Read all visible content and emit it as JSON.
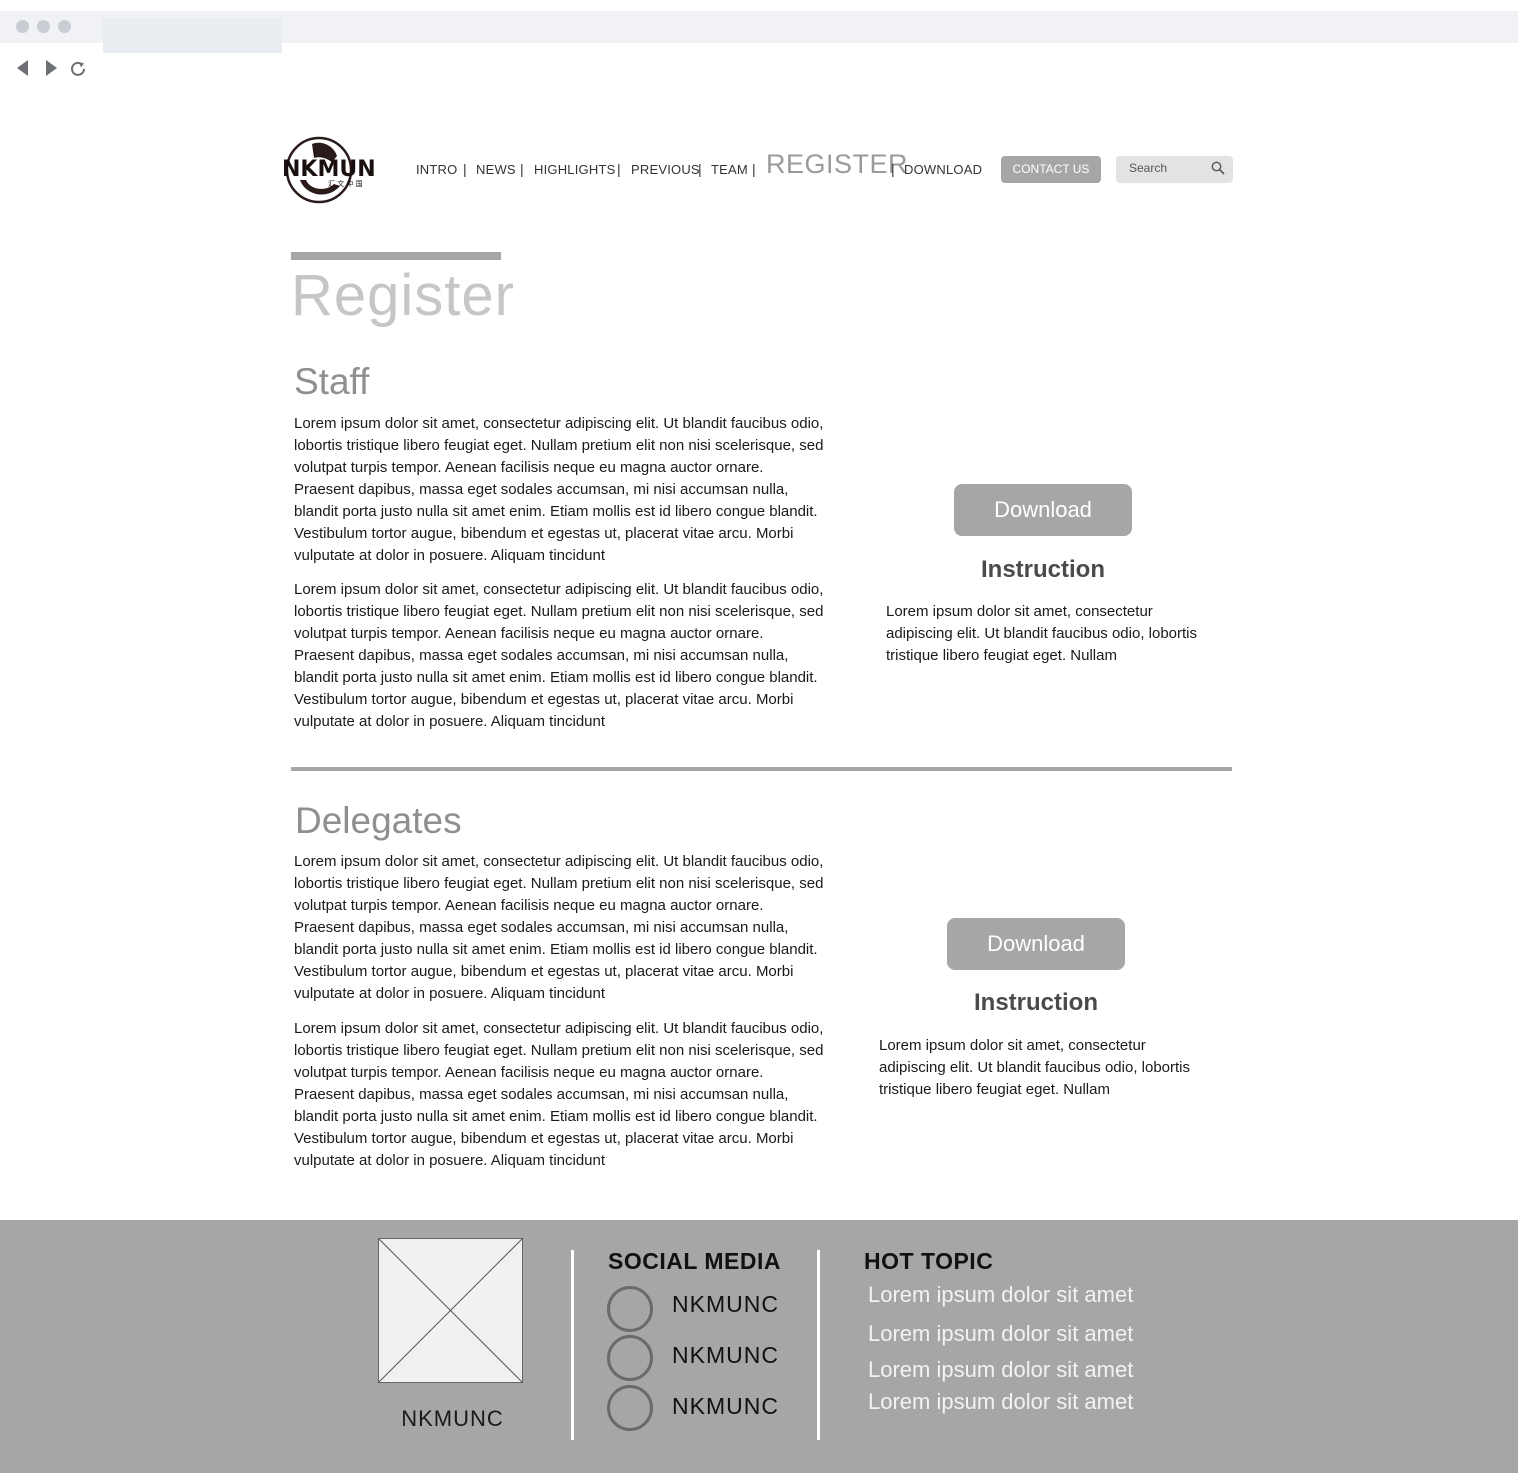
{
  "nav": {
    "items": [
      "INTRO",
      "NEWS",
      "HIGHLIGHTS",
      "PREVIOUS",
      "TEAM"
    ],
    "separator": "|",
    "register": "REGISTER",
    "download": "DOWNLOAD",
    "contact": "CONTACT US",
    "search_placeholder": "Search"
  },
  "logo": {
    "text": "NKMUN",
    "sub": "汇 文 中 国"
  },
  "page": {
    "title": "Register"
  },
  "sections": [
    {
      "title": "Staff",
      "paragraphs": [
        "Lorem ipsum dolor sit amet, consectetur adipiscing elit. Ut blandit faucibus odio, lobortis tristique libero feugiat eget. Nullam pretium elit non nisi scelerisque, sed volutpat turpis tempor. Aenean facilisis neque eu magna auctor ornare. Praesent dapibus, massa eget sodales accumsan, mi nisi accumsan nulla, blandit porta justo nulla sit amet enim. Etiam mollis est id libero congue blandit. Vestibulum tortor augue, bibendum et egestas ut, placerat vitae arcu. Morbi vulputate at dolor in posuere. Aliquam tincidunt",
        "Lorem ipsum dolor sit amet, consectetur adipiscing elit. Ut blandit faucibus odio, lobortis tristique libero feugiat eget. Nullam pretium elit non nisi scelerisque, sed volutpat turpis tempor. Aenean facilisis neque eu magna auctor ornare. Praesent dapibus, massa eget sodales accumsan, mi nisi accumsan nulla, blandit porta justo nulla sit amet enim. Etiam mollis est id libero congue blandit. Vestibulum tortor augue, bibendum et egestas ut, placerat vitae arcu. Morbi vulputate at dolor in posuere. Aliquam tincidunt"
      ],
      "download": "Download",
      "instruction_title": "Instruction",
      "instruction_text": "Lorem ipsum dolor sit amet, consectetur adipiscing elit. Ut blandit faucibus odio, lobortis tristique libero feugiat eget. Nullam"
    },
    {
      "title": "Delegates",
      "paragraphs": [
        "Lorem ipsum dolor sit amet, consectetur adipiscing elit. Ut blandit faucibus odio, lobortis tristique libero feugiat eget. Nullam pretium elit non nisi scelerisque, sed volutpat turpis tempor. Aenean facilisis neque eu magna auctor ornare. Praesent dapibus, massa eget sodales accumsan, mi nisi accumsan nulla, blandit porta justo nulla sit amet enim. Etiam mollis est id libero congue blandit. Vestibulum tortor augue, bibendum et egestas ut, placerat vitae arcu. Morbi vulputate at dolor in posuere. Aliquam tincidunt",
        "Lorem ipsum dolor sit amet, consectetur adipiscing elit. Ut blandit faucibus odio, lobortis tristique libero feugiat eget. Nullam pretium elit non nisi scelerisque, sed volutpat turpis tempor. Aenean facilisis neque eu magna auctor ornare. Praesent dapibus, massa eget sodales accumsan, mi nisi accumsan nulla, blandit porta justo nulla sit amet enim. Etiam mollis est id libero congue blandit. Vestibulum tortor augue, bibendum et egestas ut, placerat vitae arcu. Morbi vulputate at dolor in posuere. Aliquam tincidunt"
      ],
      "download": "Download",
      "instruction_title": "Instruction",
      "instruction_text": "Lorem ipsum dolor sit amet, consectetur adipiscing elit. Ut blandit faucibus odio, lobortis tristique libero feugiat eget. Nullam"
    }
  ],
  "footer": {
    "brand": "NKMUNC",
    "social_title": "SOCIAL MEDIA",
    "social": [
      "NKMUNC",
      "NKMUNC",
      "NKMUNC"
    ],
    "hot_title": "HOT TOPIC",
    "hot": [
      "Lorem ipsum dolor sit amet",
      "Lorem ipsum dolor sit amet",
      "Lorem ipsum dolor sit amet",
      "Lorem ipsum dolor sit amet"
    ]
  },
  "icons": {
    "back": "back-arrow-icon",
    "forward": "forward-arrow-icon",
    "reload": "reload-icon",
    "search": "search-icon",
    "image_placeholder": "image-placeholder-icon"
  },
  "colors": {
    "accent_gray": "#a6a6a6",
    "title_gray": "#c6c6c6",
    "heading_gray": "#8f8f8f"
  }
}
